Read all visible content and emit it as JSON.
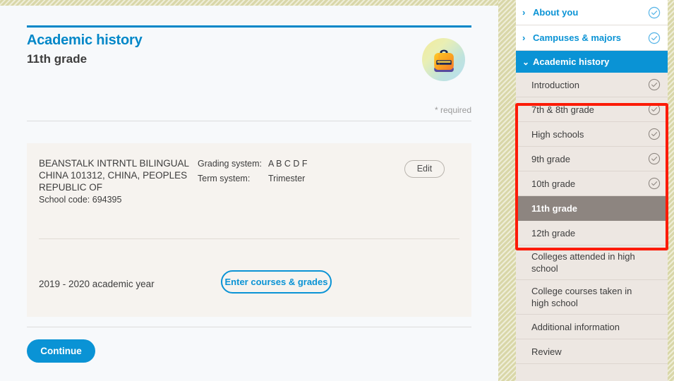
{
  "page": {
    "title": "Academic history",
    "subtitle": "11th grade",
    "required_note": "* required",
    "badge_icon": "backpack-icon"
  },
  "school_card": {
    "name": "BEANSTALK INTRNTL BILINGUAL CHINA 101312, CHINA, PEOPLES REPUBLIC OF",
    "school_code": "School code: 694395",
    "grading_label": "Grading system:",
    "grading_value": "A B C D F",
    "term_label": "Term system:",
    "term_value": "Trimester",
    "edit_label": "Edit",
    "academic_year": "2019 - 2020 academic year",
    "enter_courses_label": "Enter courses & grades"
  },
  "footer": {
    "continue_label": "Continue"
  },
  "sidebar": {
    "top_sections": [
      {
        "label": "About you",
        "chevron": "chevron-right-icon",
        "status": "complete-blue"
      },
      {
        "label": "Campuses & majors",
        "chevron": "chevron-right-icon",
        "status": "complete-blue"
      }
    ],
    "current_section": {
      "label": "Academic history",
      "chevron": "chevron-down-icon"
    },
    "sub_items": [
      {
        "label": "Introduction",
        "status": "complete-gray",
        "selected": false
      },
      {
        "label": "7th & 8th grade",
        "status": "complete-gray",
        "selected": false
      },
      {
        "label": "High schools",
        "status": "complete-gray",
        "selected": false
      },
      {
        "label": "9th grade",
        "status": "complete-gray",
        "selected": false
      },
      {
        "label": "10th grade",
        "status": "complete-gray",
        "selected": false
      },
      {
        "label": "11th grade",
        "status": "none",
        "selected": true
      },
      {
        "label": "12th grade",
        "status": "none",
        "selected": false
      },
      {
        "label": "Colleges attended in high school",
        "status": "none",
        "selected": false
      },
      {
        "label": "College courses taken in high school",
        "status": "none",
        "selected": false
      },
      {
        "label": "Additional information",
        "status": "none",
        "selected": false
      },
      {
        "label": "Review",
        "status": "none",
        "selected": false
      }
    ]
  },
  "annotation": {
    "highlight_color": "#fc1b07",
    "highlight_target": "grade-sub-items-group"
  },
  "colors": {
    "accent_blue": "#0a93d5",
    "title_blue": "#0287c8",
    "selected_row": "#8d8580",
    "sidebar_bg": "#ede7e2",
    "card_bg": "#f6f3ef",
    "page_bg": "#f7f9fb",
    "stripe_band": "#d9d7a8"
  }
}
